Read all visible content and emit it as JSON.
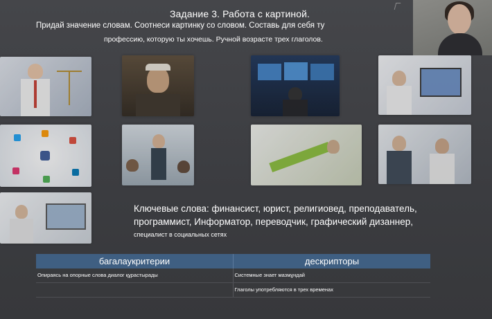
{
  "slide": {
    "title": "Задание 3. Работа с картиной.",
    "instruction_line1": "Придай значение словам. Соотнеси картинку со словом. Составь для себя ту",
    "instruction_line2": "профессию, которую ты хочешь. Ручной возрасте трех глаголов.",
    "keywords_line1": "Ключевые слова: финансист, юрист, религиовед, преподаватель,",
    "keywords_line2": "программист, Информатор, переводчик, графический дизаннер,",
    "keywords_line3": "специалист в социальных сетях"
  },
  "table": {
    "headers": [
      "багалаукритерии",
      "дескрипторы"
    ],
    "rows": [
      [
        "Опираясь на опорные слова диалог құрастырады",
        "Системные знает мазмұндай"
      ],
      [
        "",
        "Глаголы употребляются в трех временах"
      ]
    ]
  },
  "images": [
    "lawyer-justice-image",
    "religious-scholar-image",
    "programmer-monitors-image",
    "financier-laptop-image",
    "social-network-icons-image",
    "teacher-classroom-image",
    "translator-image",
    "business-meeting-image",
    "graphic-designer-image"
  ]
}
